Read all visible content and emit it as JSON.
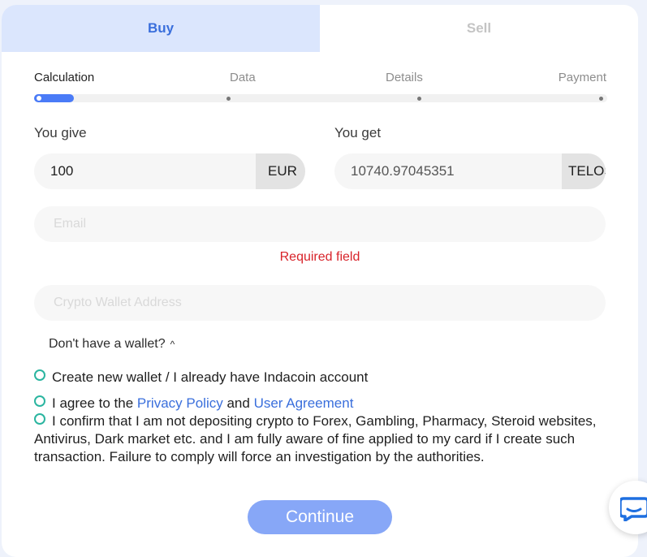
{
  "tabs": [
    {
      "label": "Buy"
    },
    {
      "label": "Sell"
    }
  ],
  "steps": [
    {
      "label": "Calculation"
    },
    {
      "label": "Data"
    },
    {
      "label": "Details"
    },
    {
      "label": "Payment"
    }
  ],
  "progress_percent": 7,
  "give": {
    "label": "You give",
    "value": "100",
    "currency": "EUR"
  },
  "get": {
    "label": "You get",
    "value": "10740.97045351",
    "currency": "TELOS"
  },
  "email": {
    "placeholder": "Email",
    "error": "Required field"
  },
  "wallet": {
    "placeholder": "Crypto Wallet Address"
  },
  "wallet_toggle": {
    "label": "Don't have a wallet?"
  },
  "checks": {
    "create_wallet": "Create new wallet / I already have Indacoin account",
    "agree_prefix": "I agree to the",
    "privacy_policy": "Privacy Policy",
    "and": "and",
    "user_agreement": "User Agreement",
    "confirm": "I confirm that I am not depositing crypto to Forex, Gambling, Pharmacy, Steroid websites, Antivirus, Dark market etc. and I am fully aware of fine applied to my card if I create such transaction. Failure to comply will force an investigation by the authorities."
  },
  "continue_label": "Continue",
  "icons": {
    "chevron": "chevron-up-icon",
    "chat": "chat-bubble-icon"
  },
  "colors": {
    "accent": "#4a7bf7",
    "active_tab_bg": "#dbe6fd",
    "link": "#3a6fdc",
    "error": "#d8232a",
    "radio": "#2bb5a0",
    "button": "#87a7f7"
  }
}
